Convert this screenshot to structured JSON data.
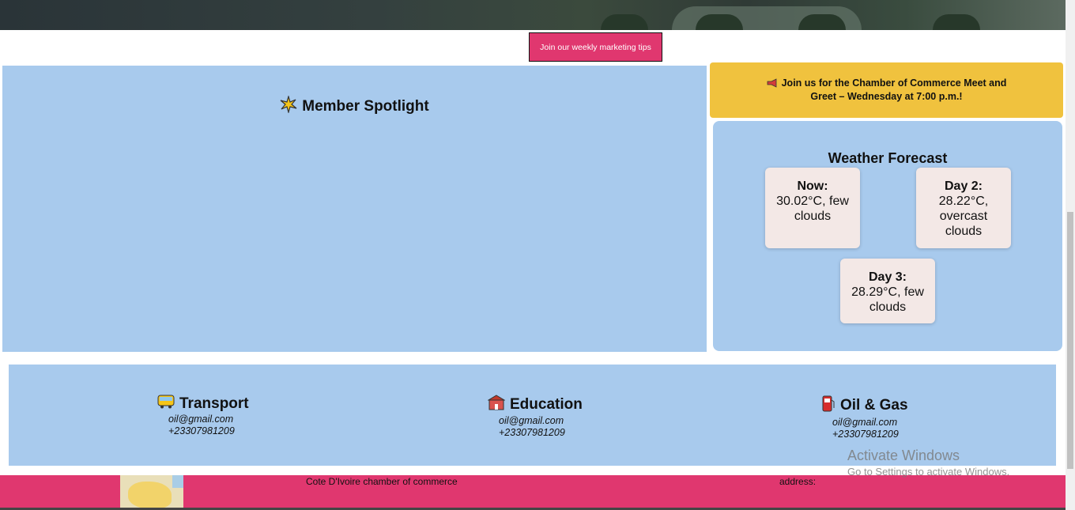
{
  "header": {
    "join_tips_label": "Join our weekly marketing tips"
  },
  "spotlight": {
    "icon": "sparkle-icon",
    "title": "Member Spotlight"
  },
  "announcement": {
    "icon": "megaphone-icon",
    "text": "Join us for the Chamber of Commerce Meet and Greet – Wednesday at 7:00 p.m.!"
  },
  "weather": {
    "title": "Weather Forecast",
    "forecasts": [
      {
        "label": "Now:",
        "value": "30.02°C, few clouds"
      },
      {
        "label": "Day 2:",
        "value": "28.22°C, overcast clouds"
      },
      {
        "label": "Day 3:",
        "value": "28.29°C, few clouds"
      }
    ]
  },
  "categories": [
    {
      "icon": "bus-icon",
      "title": "Transport",
      "email": "oil@gmail.com",
      "phone": "+23307981209"
    },
    {
      "icon": "school-icon",
      "title": "Education",
      "email": "oil@gmail.com",
      "phone": "+23307981209"
    },
    {
      "icon": "fuel-pump-icon",
      "title": "Oil & Gas",
      "email": "oil@gmail.com",
      "phone": "+23307981209"
    }
  ],
  "footer": {
    "name": "Cote D'Ivoire chamber of commerce",
    "address_label": "address:",
    "map_icon": "map-icon"
  },
  "os_watermark": {
    "title": "Activate Windows",
    "subtitle": "Go to Settings to activate Windows."
  },
  "colors": {
    "accent": "#e0376f",
    "panel": "#a8caed",
    "banner": "#f0c23e",
    "card": "#f3e8e6"
  }
}
